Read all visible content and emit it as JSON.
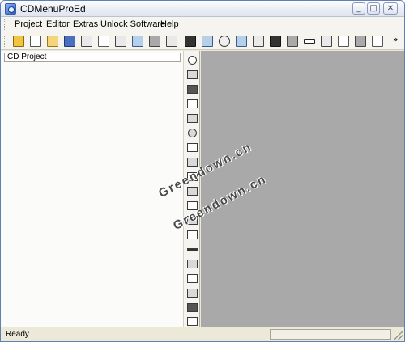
{
  "window": {
    "title": "CDMenuProEd"
  },
  "menu": {
    "items": [
      {
        "label": "Project"
      },
      {
        "label": "Editor"
      },
      {
        "label": "Extras"
      },
      {
        "label": "Unlock Software"
      },
      {
        "label": "Help"
      }
    ]
  },
  "toolbar": {
    "overflow_label": "»"
  },
  "left_panel": {
    "header": "CD Project"
  },
  "watermark": {
    "text1": "Greendown.cn",
    "text2": "Greendown.cn"
  },
  "status": {
    "text": "Ready",
    "pane_text": ""
  },
  "colors": {
    "workspace": "#a9a9a9",
    "chrome": "#ece9d8"
  }
}
